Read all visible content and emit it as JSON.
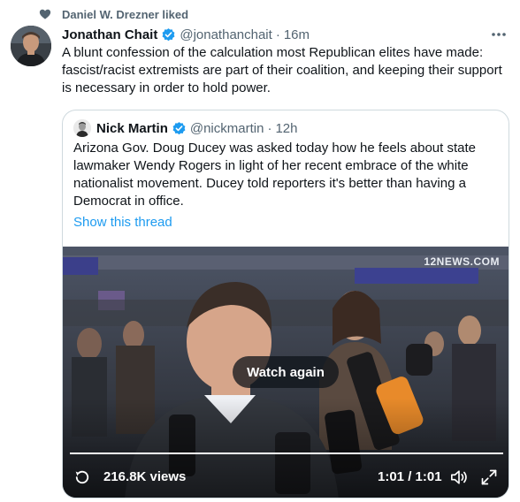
{
  "social_context": {
    "text": "Daniel W. Drezner liked",
    "icon": "heart-icon"
  },
  "tweet": {
    "author_name": "Jonathan Chait",
    "verified": true,
    "handle": "@jonathanchait",
    "separator": "·",
    "time": "16m",
    "text": "A blunt confession of the calculation most Republican elites have made: fascist/racist extremists are part of their coalition, and keeping their support is necessary in order to hold power."
  },
  "quoted_tweet": {
    "author_name": "Nick Martin",
    "verified": true,
    "handle": "@nickmartin",
    "separator": "·",
    "time": "12h",
    "text": "Arizona Gov. Doug Ducey was asked today how he feels about state lawmaker Wendy Rogers in light of her recent embrace of the white nationalist movement. Ducey told reporters it's better than having a Democrat in office.",
    "show_thread_label": "Show this thread",
    "video": {
      "overlay_logo": "12NEWS.COM",
      "watch_again_label": "Watch again",
      "views": "216.8K views",
      "timecode": "1:01 / 1:01",
      "progress": 1.0
    }
  },
  "colors": {
    "accent": "#1d9bf0",
    "text_primary": "#0f1419",
    "text_secondary": "#536471",
    "border": "#cfd9de"
  }
}
